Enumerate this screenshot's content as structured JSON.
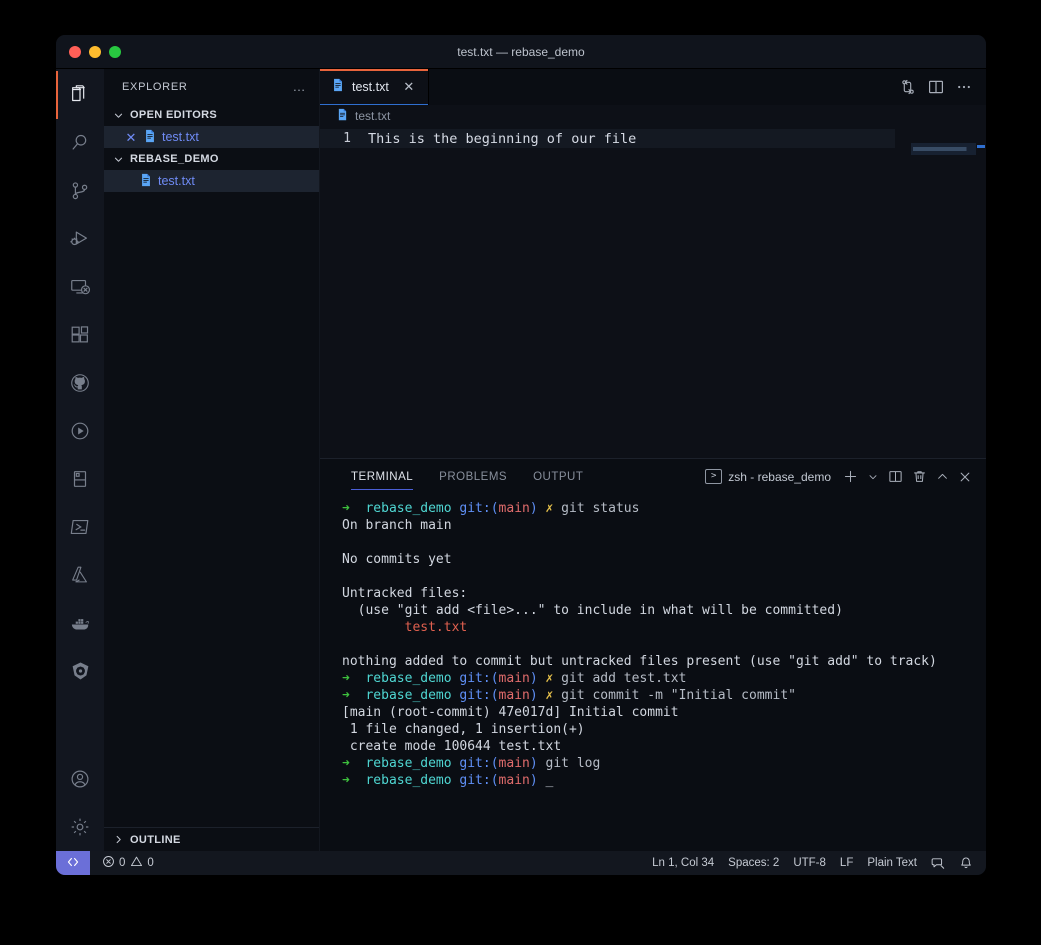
{
  "window": {
    "title": "test.txt — rebase_demo",
    "traffic_lights": [
      "close",
      "minimize",
      "zoom"
    ]
  },
  "activity_bar": {
    "items": [
      {
        "icon": "files-explorer-icon",
        "name": "explorer",
        "active": true
      },
      {
        "icon": "search-icon",
        "name": "search",
        "active": false
      },
      {
        "icon": "source-control-icon",
        "name": "source-control",
        "active": false
      },
      {
        "icon": "run-and-debug-icon",
        "name": "run-and-debug",
        "active": false
      },
      {
        "icon": "remote-explorer-icon",
        "name": "remote-explorer",
        "active": false
      },
      {
        "icon": "extensions-icon",
        "name": "extensions",
        "active": false
      },
      {
        "icon": "github-icon",
        "name": "github",
        "active": false
      },
      {
        "icon": "play-circle-icon",
        "name": "testing",
        "active": false
      },
      {
        "icon": "database-icon",
        "name": "database",
        "active": false
      },
      {
        "icon": "powershell-icon",
        "name": "powershell",
        "active": false
      },
      {
        "icon": "azure-icon",
        "name": "azure",
        "active": false
      },
      {
        "icon": "docker-icon",
        "name": "docker",
        "active": false
      },
      {
        "icon": "kubernetes-icon",
        "name": "kubernetes",
        "active": false
      }
    ],
    "bottom_items": [
      {
        "icon": "account-icon",
        "name": "accounts"
      },
      {
        "icon": "gear-icon",
        "name": "manage-settings"
      }
    ]
  },
  "sidebar": {
    "title": "EXPLORER",
    "more_actions": "…",
    "sections": [
      {
        "label": "OPEN EDITORS",
        "expanded": true,
        "rows": [
          {
            "label": "test.txt",
            "icon": "text-file-icon",
            "selected": true,
            "close": "✕"
          }
        ]
      },
      {
        "label": "REBASE_DEMO",
        "expanded": true,
        "rows": [
          {
            "label": "test.txt",
            "icon": "text-file-icon",
            "selected": true
          }
        ]
      }
    ],
    "outline_label": "OUTLINE",
    "outline_expanded": false
  },
  "editor": {
    "tabs": [
      {
        "label": "test.txt",
        "icon": "text-file-icon",
        "active": true,
        "close": "✕"
      }
    ],
    "actions": [
      "source-control-compare-icon",
      "split-editor-icon",
      "more-actions-icon"
    ],
    "breadcrumb": "test.txt",
    "lines": [
      {
        "number": "1",
        "text": "This is the beginning of our file"
      }
    ]
  },
  "panel": {
    "tabs": [
      {
        "label": "TERMINAL",
        "active": true
      },
      {
        "label": "PROBLEMS",
        "active": false
      },
      {
        "label": "OUTPUT",
        "active": false
      }
    ],
    "terminal_selector": "zsh - rebase_demo",
    "actions": [
      "new-terminal-icon",
      "chevron-down-icon",
      "split-terminal-icon",
      "kill-terminal-icon",
      "maximize-panel-icon",
      "close-panel-icon"
    ],
    "terminal_lines": [
      {
        "type": "prompt",
        "cwd": "rebase_demo",
        "branch": "main",
        "dirty": true,
        "command": "git status"
      },
      {
        "type": "out",
        "text": "On branch main"
      },
      {
        "type": "out",
        "text": ""
      },
      {
        "type": "out",
        "text": "No commits yet"
      },
      {
        "type": "out",
        "text": ""
      },
      {
        "type": "out",
        "text": "Untracked files:"
      },
      {
        "type": "out",
        "text": "  (use \"git add <file>...\" to include in what will be committed)"
      },
      {
        "type": "file",
        "text": "        test.txt"
      },
      {
        "type": "out",
        "text": ""
      },
      {
        "type": "out",
        "text": "nothing added to commit but untracked files present (use \"git add\" to track)"
      },
      {
        "type": "prompt",
        "cwd": "rebase_demo",
        "branch": "main",
        "dirty": true,
        "command": "git add test.txt"
      },
      {
        "type": "prompt",
        "cwd": "rebase_demo",
        "branch": "main",
        "dirty": true,
        "command": "git commit -m \"Initial commit\""
      },
      {
        "type": "out",
        "text": "[main (root-commit) 47e017d] Initial commit"
      },
      {
        "type": "out",
        "text": " 1 file changed, 1 insertion(+)"
      },
      {
        "type": "out",
        "text": " create mode 100644 test.txt"
      },
      {
        "type": "prompt",
        "cwd": "rebase_demo",
        "branch": "main",
        "dirty": false,
        "command": "git log"
      },
      {
        "type": "prompt",
        "cwd": "rebase_demo",
        "branch": "main",
        "dirty": false,
        "command": "",
        "cursor": "_"
      }
    ]
  },
  "status_bar": {
    "remote_icon": "remote-window-icon",
    "errors": "0",
    "warnings": "0",
    "cursor_position": "Ln 1, Col 34",
    "indentation": "Spaces: 2",
    "encoding": "UTF-8",
    "eol": "LF",
    "language": "Plain Text",
    "feedback_icon": "feedback-icon",
    "bell_icon": "bell-icon"
  },
  "colors": {
    "accent_orange": "#e8643c",
    "accent_blue": "#2f6fd0",
    "remote_purple": "#6b6fd8",
    "terminal_green": "#3ec13e",
    "terminal_cyan": "#4fd6d2",
    "terminal_blue": "#5f8ff5",
    "terminal_red": "#e06c6c",
    "terminal_yellow": "#e5c04b",
    "file_link_blue": "#6f8bf5"
  }
}
